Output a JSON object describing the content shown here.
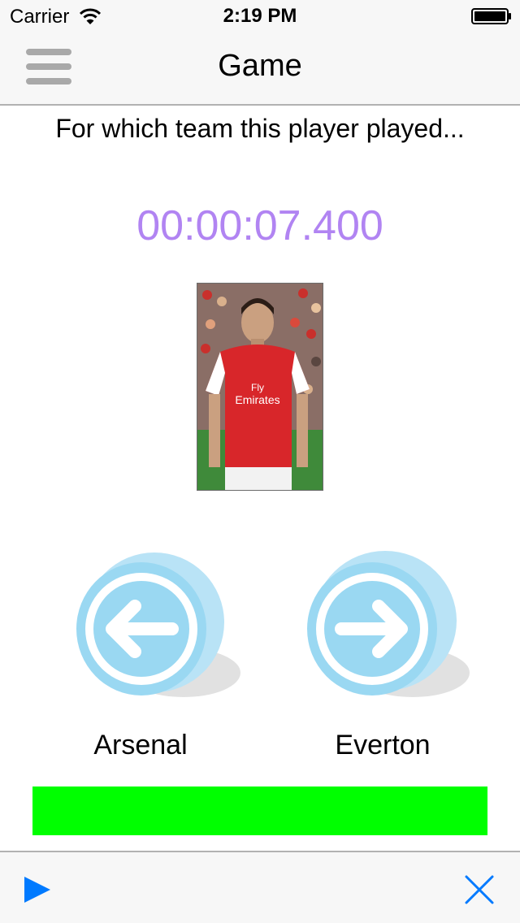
{
  "status_bar": {
    "carrier": "Carrier",
    "time": "2:19 PM",
    "wifi_icon": "wifi-icon",
    "battery_icon": "battery-icon"
  },
  "nav_bar": {
    "title": "Game",
    "menu_icon": "hamburger-menu-icon"
  },
  "game": {
    "question": "For which team this player played...",
    "timer": "00:00:07.400",
    "player_photo": "player-photo",
    "answers": [
      {
        "label": "Arsenal",
        "icon": "left-arrow-circle-icon"
      },
      {
        "label": "Everton",
        "icon": "right-arrow-circle-icon"
      }
    ],
    "progress": 1.0
  },
  "toolbar": {
    "play_icon": "play-icon",
    "close_icon": "close-icon"
  },
  "colors": {
    "timer": "#b184f2",
    "accent": "#007aff",
    "progress": "#00ff00",
    "answer_button": "#9ad8f2"
  }
}
